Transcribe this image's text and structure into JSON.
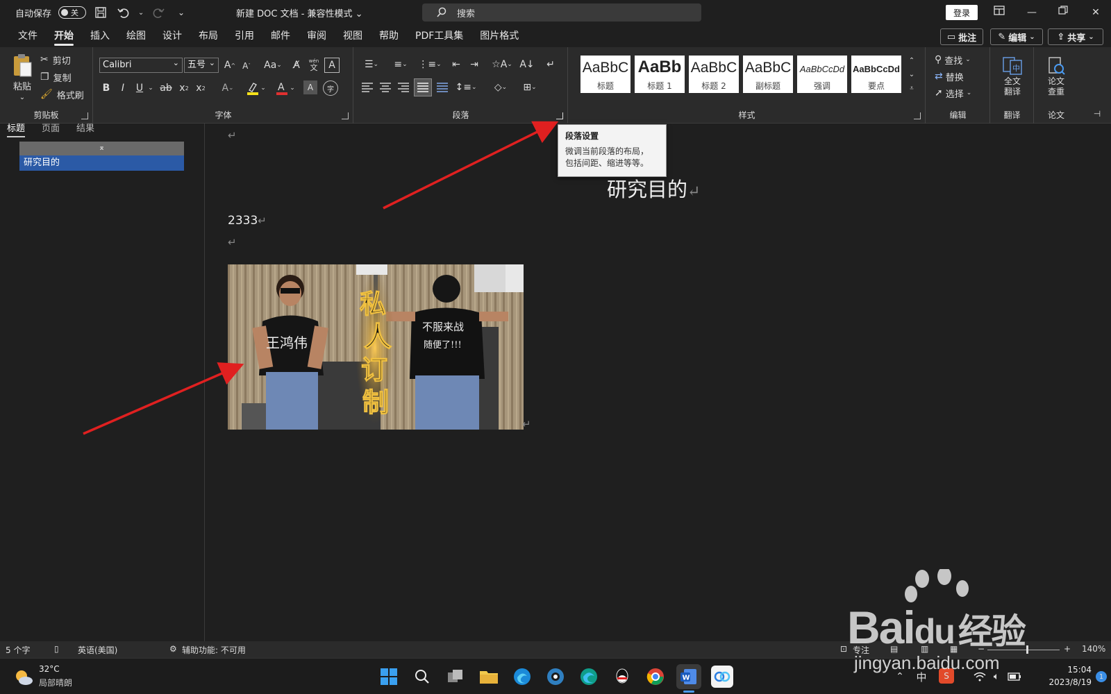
{
  "titlebar": {
    "autosave_label": "自动保存",
    "autosave_state": "关",
    "doc_title": "新建 DOC 文档 - 兼容性模式 ⌄",
    "search_placeholder": "搜索",
    "login_label": "登录",
    "icons": [
      "save-icon",
      "undo-icon",
      "redo-icon",
      "customize-icon",
      "ribbon-display-icon",
      "minimize-icon",
      "restore-icon",
      "close-icon"
    ]
  },
  "menu": {
    "tabs": [
      "文件",
      "开始",
      "插入",
      "绘图",
      "设计",
      "布局",
      "引用",
      "邮件",
      "审阅",
      "视图",
      "帮助",
      "PDF工具集",
      "图片格式"
    ],
    "active_index": 1,
    "comment_label": "批注",
    "edit_label": "编辑",
    "share_label": "共享"
  },
  "ribbon": {
    "clipboard": {
      "label": "剪贴板",
      "paste": "粘贴",
      "cut": "剪切",
      "copy": "复制",
      "format_painter": "格式刷"
    },
    "font": {
      "label": "字体",
      "font_name": "Calibri",
      "font_size": "五号",
      "wen": "wén",
      "wen2": "文"
    },
    "paragraph": {
      "label": "段落"
    },
    "styles": {
      "label": "样式",
      "items": [
        {
          "sample": "AaBbC",
          "name": "标题"
        },
        {
          "sample": "AaBb",
          "name": "标题 1"
        },
        {
          "sample": "AaBbC",
          "name": "标题 2"
        },
        {
          "sample": "AaBbC",
          "name": "副标题"
        },
        {
          "sample": "AaBbCcDd",
          "name": "强调"
        },
        {
          "sample": "AaBbCcDd",
          "name": "要点"
        }
      ]
    },
    "editing": {
      "label": "编辑",
      "find": "查找",
      "replace": "替换",
      "select": "选择"
    },
    "translate": {
      "label": "翻译",
      "button": "全文翻译",
      "line1": "全文",
      "line2": "翻译"
    },
    "paper": {
      "label": "论文",
      "line1": "论文",
      "line2": "查重"
    }
  },
  "nav": {
    "tabs": [
      "标题",
      "页面",
      "结果"
    ],
    "heading": "研究目的"
  },
  "document": {
    "heading": "研究目的",
    "number": "2333",
    "pilcrow": "↵",
    "photo_text": {
      "vertical": [
        "私",
        "人",
        "订",
        "制"
      ],
      "left_shirt": "王鸿伟",
      "right_shirt_1": "不服来战",
      "right_shirt_2": "随便了!!!"
    }
  },
  "tooltip": {
    "title": "段落设置",
    "body_1": "微调当前段落的布局，",
    "body_2": "包括间距、缩进等等。"
  },
  "statusbar": {
    "word_count": "5 个字",
    "language": "英语(美国)",
    "accessibility": "辅助功能: 不可用",
    "focus": "专注",
    "zoom": "140%"
  },
  "taskbar": {
    "temperature": "32°C",
    "weather": "局部晴朗",
    "ime": "中",
    "time": "15:04",
    "date": "2023/8/19",
    "notifications": "1"
  },
  "watermark": {
    "brand": "Bai",
    "brand_du": "du",
    "brand_cn": "经验",
    "url": "jingyan.baidu.com"
  },
  "colors": {
    "accent_blue": "#2b5aa6",
    "arrow_red": "#e02020",
    "highlight_yellow": "#f5e11a",
    "font_color_red": "#e03030"
  }
}
